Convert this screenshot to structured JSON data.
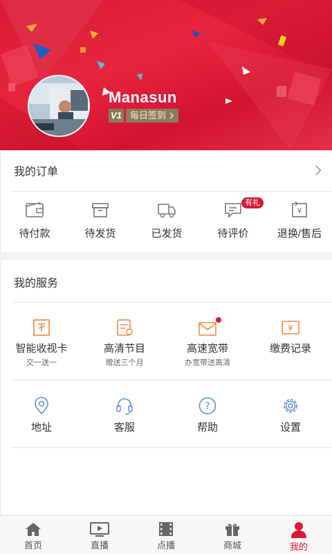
{
  "profile": {
    "username": "Manasun",
    "vip_badge": "V1",
    "checkin_label": "每日签到"
  },
  "orders": {
    "title": "我的订单",
    "items": [
      {
        "label": "待付款",
        "icon": "wallet-icon"
      },
      {
        "label": "待发货",
        "icon": "box-icon"
      },
      {
        "label": "已发货",
        "icon": "truck-icon"
      },
      {
        "label": "待评价",
        "icon": "comment-icon",
        "badge": "有礼"
      },
      {
        "label": "退换/售后",
        "icon": "return-icon"
      }
    ]
  },
  "services": {
    "title": "我的服务",
    "items": [
      {
        "label": "智能收视卡",
        "sub": "交一送一",
        "icon": "tv-card-icon"
      },
      {
        "label": "高清节目",
        "sub": "赠送三个月",
        "icon": "hd-program-icon"
      },
      {
        "label": "高速宽带",
        "sub": "办宽带送高清",
        "icon": "broadband-icon"
      },
      {
        "label": "缴费记录",
        "icon": "payment-record-icon"
      },
      {
        "label": "地址",
        "icon": "location-icon"
      },
      {
        "label": "客服",
        "icon": "headset-icon"
      },
      {
        "label": "帮助",
        "icon": "help-icon"
      },
      {
        "label": "设置",
        "icon": "settings-icon"
      }
    ]
  },
  "nav": {
    "items": [
      {
        "label": "首页",
        "icon": "home-icon"
      },
      {
        "label": "直播",
        "icon": "live-tv-icon"
      },
      {
        "label": "点播",
        "icon": "film-icon"
      },
      {
        "label": "商城",
        "icon": "gift-icon"
      },
      {
        "label": "我的",
        "icon": "user-icon",
        "active": true
      }
    ]
  },
  "colors": {
    "brand_red": "#d81a35",
    "service_orange": "#f0883a",
    "service_blue": "#5b8fd6",
    "badge_gold": "#8a7b5d"
  }
}
